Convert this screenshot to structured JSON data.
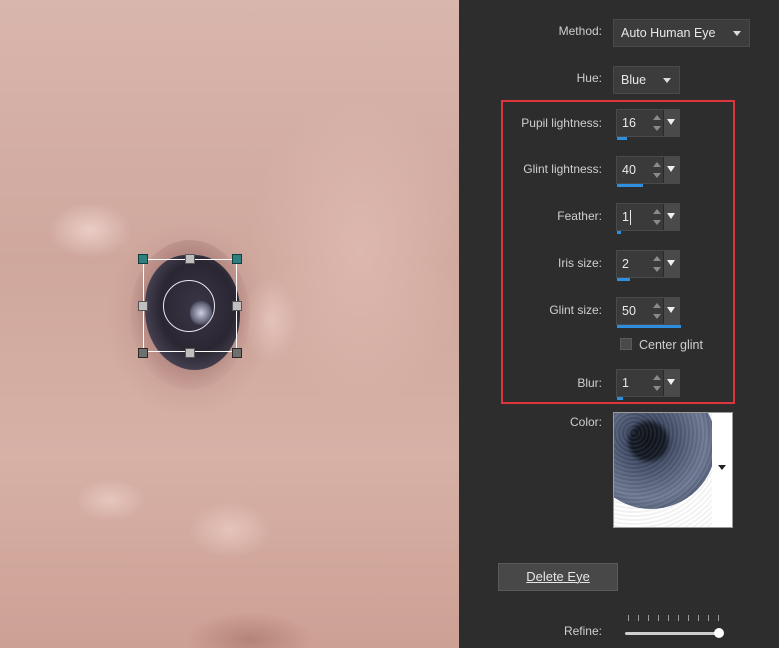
{
  "panel": {
    "method": {
      "label": "Method:",
      "value": "Auto Human Eye"
    },
    "hue": {
      "label": "Hue:",
      "value": "Blue"
    },
    "pupil_lightness": {
      "label": "Pupil lightness:",
      "value": "16",
      "fraction": 0.16
    },
    "glint_lightness": {
      "label": "Glint lightness:",
      "value": "40",
      "fraction": 0.4
    },
    "feather": {
      "label": "Feather:",
      "value": "1",
      "fraction": 0.05
    },
    "iris_size": {
      "label": "Iris size:",
      "value": "2",
      "fraction": 0.2
    },
    "glint_size": {
      "label": "Glint size:",
      "value": "50",
      "fraction": 1.0
    },
    "center_glint": {
      "label": "Center glint",
      "checked": false
    },
    "blur": {
      "label": "Blur:",
      "value": "1",
      "fraction": 0.1
    },
    "color": {
      "label": "Color:"
    },
    "delete_eye": {
      "label": "Delete Eye"
    },
    "refine": {
      "label": "Refine:",
      "fraction": 1.0
    }
  },
  "colors": {
    "highlight": "#e0343c",
    "accent": "#2e8fe0"
  }
}
